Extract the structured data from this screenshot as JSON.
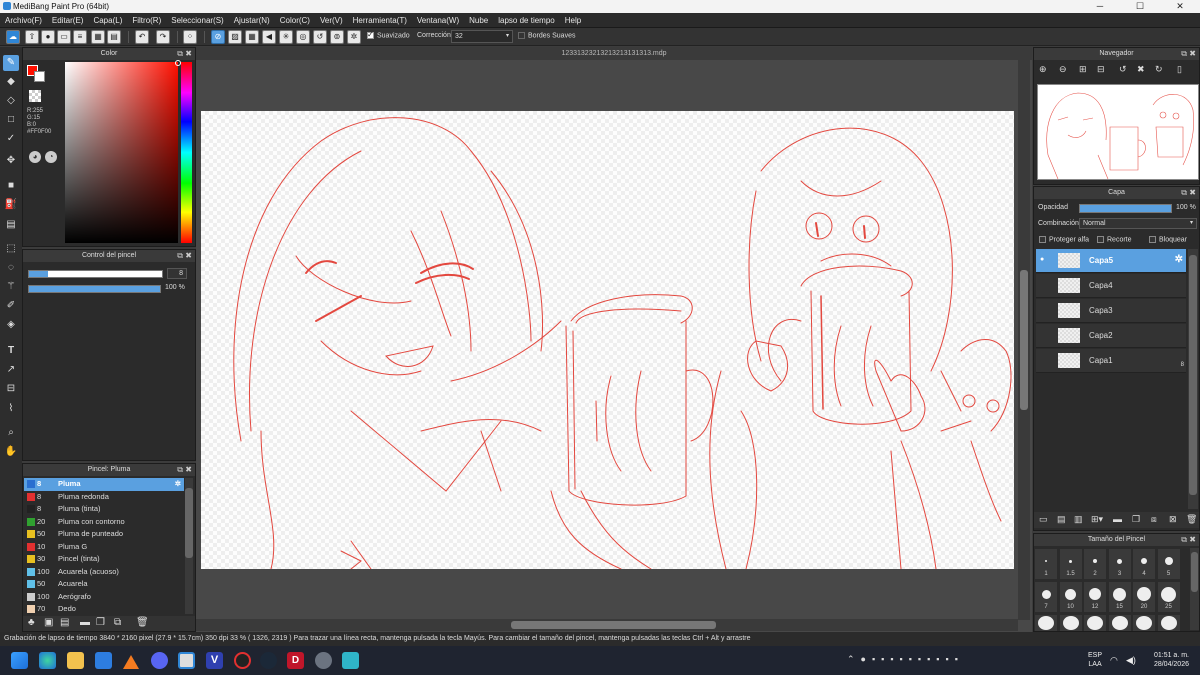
{
  "window": {
    "title": "MediBang Paint Pro (64bit)",
    "min": "─",
    "max": "☐",
    "close": "✕"
  },
  "menu": [
    "Archivo(F)",
    "Editar(E)",
    "Capa(L)",
    "Filtro(R)",
    "Seleccionar(S)",
    "Ajustar(N)",
    "Color(C)",
    "Ver(V)",
    "Herramienta(T)",
    "Ventana(W)",
    "Nube",
    "lapso de tiempo",
    "Help"
  ],
  "toolbar": {
    "smoothing_label": "Suavizado",
    "correction_label": "Corrección",
    "correction_value": "32",
    "soft_edges_label": "Bordes Suaves"
  },
  "color_panel": {
    "title": "Color",
    "r": "R:255",
    "g": "G:15",
    "b": "B:0",
    "hex": "#FF0F00",
    "main_color": "#ff0f00"
  },
  "brush_control": {
    "title": "Control del pincel",
    "size": "8",
    "opacity": "100 %"
  },
  "brush_list": {
    "title": "Pincel: Pluma",
    "items": [
      {
        "size": "8",
        "name": "Pluma",
        "color": "#2a6fd0"
      },
      {
        "size": "8",
        "name": "Pluma redonda",
        "color": "#e23030"
      },
      {
        "size": "8",
        "name": "Pluma (tinta)",
        "color": "#222222"
      },
      {
        "size": "20",
        "name": "Pluma con contorno",
        "color": "#30a030"
      },
      {
        "size": "50",
        "name": "Pluma de punteado",
        "color": "#e8c020"
      },
      {
        "size": "10",
        "name": "Pluma G",
        "color": "#e23030"
      },
      {
        "size": "30",
        "name": "Pincel (tinta)",
        "color": "#e8c020"
      },
      {
        "size": "100",
        "name": "Acuarela (acuoso)",
        "color": "#60c0e8"
      },
      {
        "size": "50",
        "name": "Acuarela",
        "color": "#60c0e8"
      },
      {
        "size": "100",
        "name": "Aerógrafo",
        "color": "#cccccc"
      },
      {
        "size": "70",
        "name": "Dedo",
        "color": "#f0d0b0"
      }
    ]
  },
  "document": {
    "tab": "12331323213213213131313.mdp"
  },
  "navigator": {
    "title": "Navegador"
  },
  "layers": {
    "title": "Capa",
    "opacity_label": "Opacidad",
    "opacity_value": "100 %",
    "blend_label": "Combinación",
    "blend_value": "Normal",
    "protect_alpha": "Proteger alfa",
    "clipping": "Recorte",
    "lock": "Bloquear",
    "items": [
      {
        "name": "Capa5"
      },
      {
        "name": "Capa4"
      },
      {
        "name": "Capa3"
      },
      {
        "name": "Capa2"
      },
      {
        "name": "Capa1",
        "badge": "8"
      }
    ]
  },
  "brush_size": {
    "title": "Tamaño del Pincel",
    "sizes": [
      "1",
      "1.5",
      "2",
      "3",
      "4",
      "5",
      "7",
      "10",
      "12",
      "15",
      "20",
      "25"
    ]
  },
  "status": {
    "text": "Grabación de lapso de tiempo   3840 * 2160 pixel   (27.9 * 15.7cm)   350 dpi   33 %   ( 1326, 2319 )   Para trazar una línea recta, mantenga pulsada la tecla Mayús. Para cambiar el tamaño del pincel, mantenga pulsadas las teclas Ctrl + Alt y arrastre"
  },
  "taskbar": {
    "lang1": "ESP",
    "lang2": "LAA",
    "time": "01:51 a. m.",
    "date": "28/04/2026"
  }
}
